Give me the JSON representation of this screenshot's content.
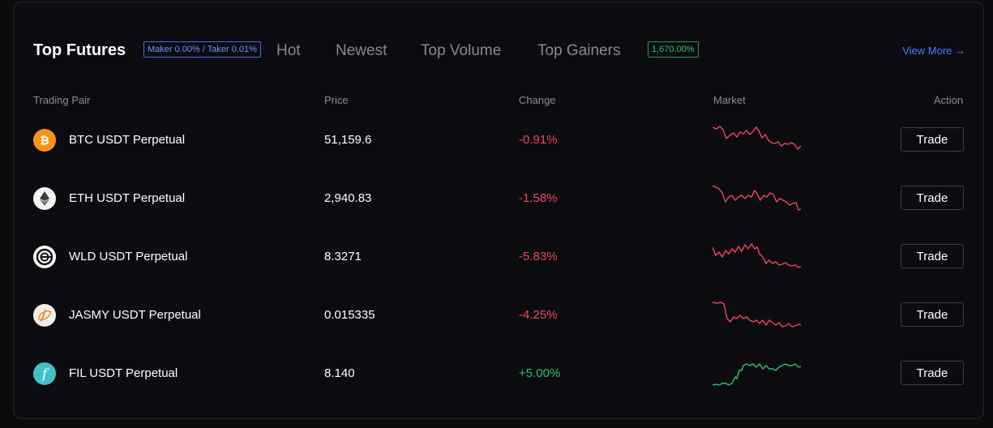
{
  "header": {
    "title": "Top Futures",
    "fee_badge": "Maker 0.00% / Taker 0.01%",
    "tabs": [
      "Hot",
      "Newest",
      "Top Volume",
      "Top Gainers"
    ],
    "gainers_badge": "1,670.00%",
    "view_more": "View More →"
  },
  "columns": {
    "pair": "Trading Pair",
    "price": "Price",
    "change": "Change",
    "market": "Market",
    "action": "Action"
  },
  "colors": {
    "negative": "#f0475c",
    "positive": "#2fc16c",
    "accent": "#4c7dff"
  },
  "rows": [
    {
      "pair": "BTC USDT Perpetual",
      "price": "51,159.6",
      "change": "-0.91%",
      "trend": "down",
      "icon": "bitcoin-icon",
      "trade": "Trade"
    },
    {
      "pair": "ETH USDT Perpetual",
      "price": "2,940.83",
      "change": "-1.58%",
      "trend": "down",
      "icon": "ethereum-icon",
      "trade": "Trade"
    },
    {
      "pair": "WLD USDT Perpetual",
      "price": "8.3271",
      "change": "-5.83%",
      "trend": "down",
      "icon": "worldcoin-icon",
      "trade": "Trade"
    },
    {
      "pair": "JASMY USDT Perpetual",
      "price": "0.015335",
      "change": "-4.25%",
      "trend": "down",
      "icon": "jasmy-icon",
      "trade": "Trade"
    },
    {
      "pair": "FIL USDT Perpetual",
      "price": "8.140",
      "change": "+5.00%",
      "trend": "up",
      "icon": "filecoin-icon",
      "trade": "Trade"
    }
  ]
}
